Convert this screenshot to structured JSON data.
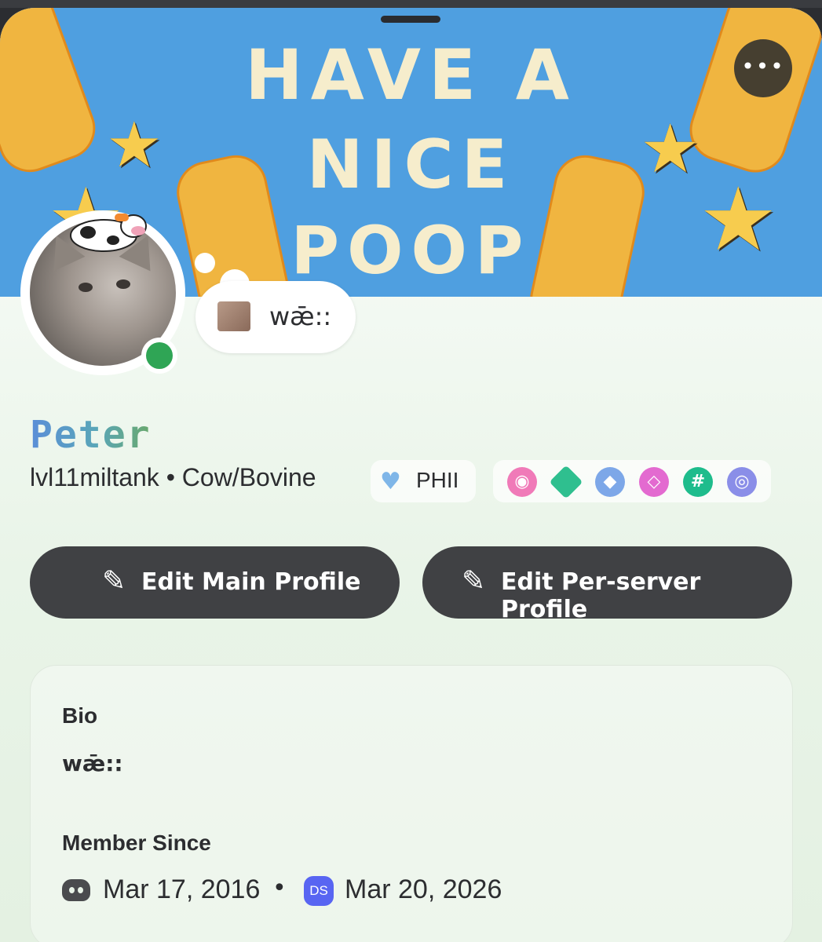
{
  "banner": {
    "line1": "HAVE A",
    "line2": "NICE",
    "line3": "POOP"
  },
  "header": {
    "more_label": "•••"
  },
  "status": {
    "text": "wǣ꞉꞉"
  },
  "profile": {
    "display_name": "Peter",
    "username": "lvl11miltank",
    "pronouns": "Cow/Bovine",
    "separator": "•",
    "tag": "PHII",
    "badges": [
      "nitro-badge-icon",
      "boost-badge-icon",
      "quest-badge-icon",
      "gem-badge-icon",
      "hashtag-badge-icon",
      "laurel-badge-icon"
    ]
  },
  "actions": {
    "edit_main": "Edit Main Profile",
    "edit_server": "Edit Per-server Profile"
  },
  "bio": {
    "title": "Bio",
    "text": "wǣ꞉꞉"
  },
  "member_since": {
    "title": "Member Since",
    "discord_date": "Mar 17, 2016",
    "separator": "•",
    "server_initials": "DS",
    "server_date": "Mar 20, 2026"
  },
  "colors": {
    "banner_bg": "#4f9fe0",
    "button_bg": "#404144",
    "online": "#2fa555",
    "server_icon": "#5865f2"
  }
}
